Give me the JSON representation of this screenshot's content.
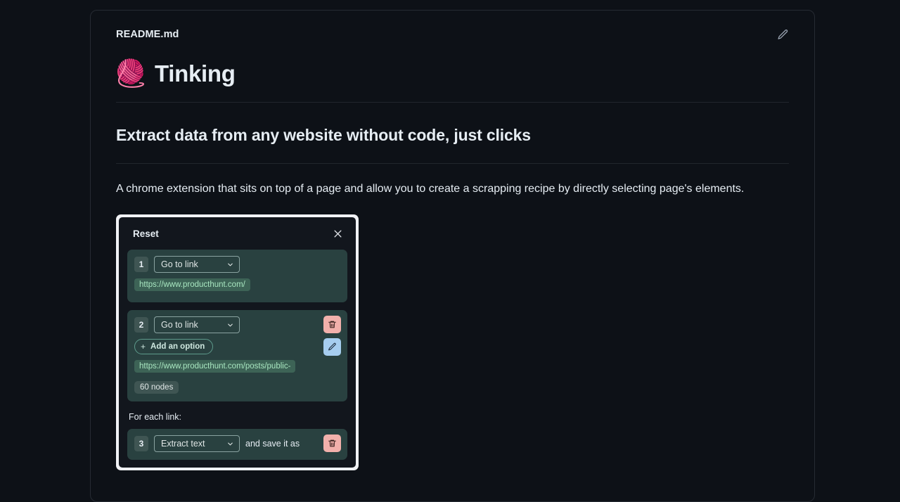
{
  "page": {
    "background_color": "#0d1117",
    "accent_color": "#ff7b29"
  },
  "card": {
    "file_name": "README.md",
    "edit_icon": "pencil-icon"
  },
  "readme": {
    "emoji": "🧶",
    "title": "Tinking",
    "subtitle": "Extract data from any website without code, just clicks",
    "intro": "A chrome extension that sits on top of a page and allow you to create a scrapping recipe by directly selecting page's elements."
  },
  "screenshot": {
    "topbar": {
      "reset_label": "Reset",
      "close_icon": "close-icon"
    },
    "steps": [
      {
        "number": "1",
        "action": "Go to link",
        "url": "https://www.producthunt.com/"
      },
      {
        "number": "2",
        "action": "Go to link",
        "add_option_label": "Add an option",
        "add_option_plus": "+",
        "url": "https://www.producthunt.com/posts/public-",
        "nodes": "60 nodes",
        "delete_icon": "trash-icon",
        "edit_icon": "pencil-icon"
      }
    ],
    "foreach_label": "For each link:",
    "step3": {
      "number": "3",
      "action": "Extract text",
      "suffix": "and save it as",
      "delete_icon": "trash-icon"
    }
  }
}
